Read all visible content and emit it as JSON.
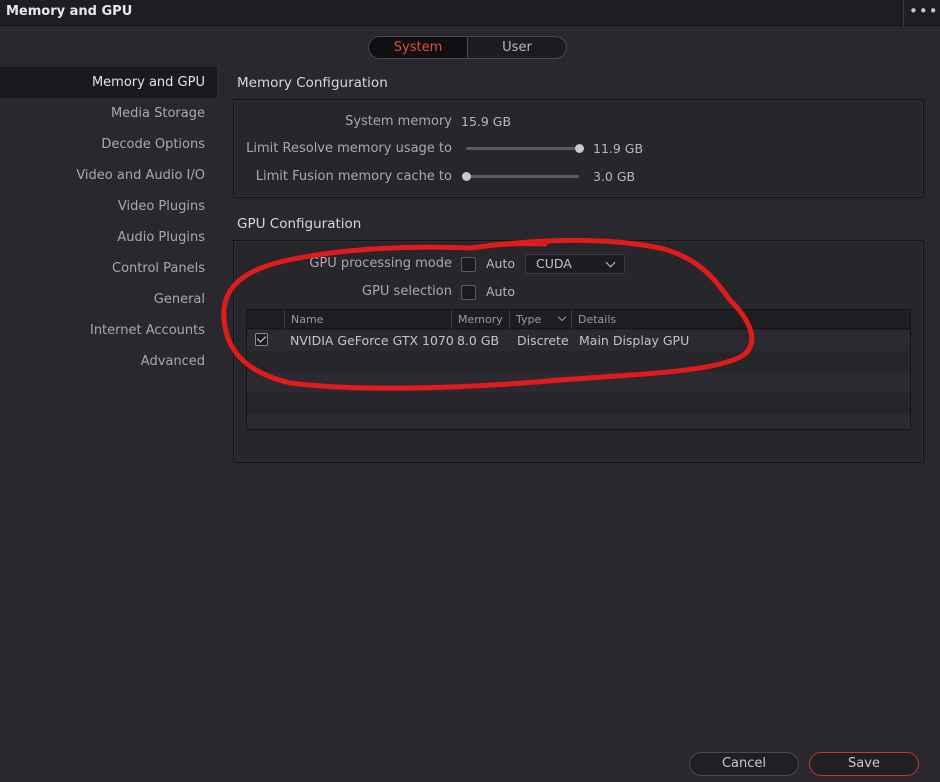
{
  "window": {
    "title": "Memory and GPU",
    "more_label": "•••"
  },
  "tabs": {
    "system": "System",
    "user": "User",
    "active": "System"
  },
  "sidebar": {
    "items": [
      {
        "label": "Memory and GPU",
        "active": true
      },
      {
        "label": "Media Storage"
      },
      {
        "label": "Decode Options"
      },
      {
        "label": "Video and Audio I/O"
      },
      {
        "label": "Video Plugins"
      },
      {
        "label": "Audio Plugins"
      },
      {
        "label": "Control Panels"
      },
      {
        "label": "General"
      },
      {
        "label": "Internet Accounts"
      },
      {
        "label": "Advanced"
      }
    ]
  },
  "memory_config": {
    "title": "Memory Configuration",
    "system_memory": {
      "label": "System memory",
      "value": "15.9 GB"
    },
    "resolve_limit": {
      "label": "Limit Resolve memory usage to",
      "value": "11.9 GB",
      "level": 1.0
    },
    "fusion_limit": {
      "label": "Limit Fusion memory cache to",
      "value": "3.0 GB",
      "level": 0.0
    }
  },
  "gpu_config": {
    "title": "GPU Configuration",
    "processing_mode": {
      "label": "GPU processing mode",
      "auto_label": "Auto",
      "auto_checked": false,
      "selected": "CUDA"
    },
    "gpu_selection": {
      "label": "GPU selection",
      "auto_label": "Auto",
      "auto_checked": false
    },
    "table": {
      "columns": {
        "name": "Name",
        "memory": "Memory",
        "type": "Type",
        "details": "Details"
      },
      "rows": [
        {
          "checked": true,
          "name": "NVIDIA GeForce GTX 1070",
          "memory": "8.0 GB",
          "type": "Discrete",
          "details": "Main Display GPU"
        }
      ]
    }
  },
  "footer": {
    "cancel": "Cancel",
    "save": "Save"
  },
  "colors": {
    "accent": "#e64b3c",
    "annotation": "#e01b1b",
    "background": "#28282e"
  }
}
